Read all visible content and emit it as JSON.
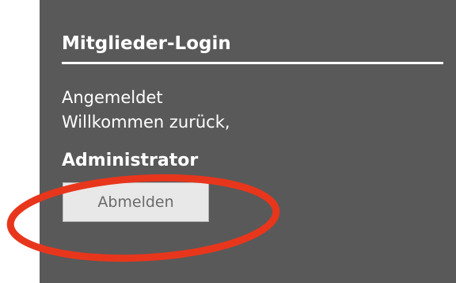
{
  "login_panel": {
    "title": "Mitglieder-Login",
    "status": "Angemeldet",
    "welcome": "Willkommen zurück,",
    "user_name": "Administrator",
    "logout_label": "Abmelden"
  },
  "colors": {
    "panel_background": "#595959",
    "text": "#ffffff",
    "button_background": "#e8e8e8",
    "button_text": "#6a6a6a",
    "annotation": "#e8361c"
  }
}
